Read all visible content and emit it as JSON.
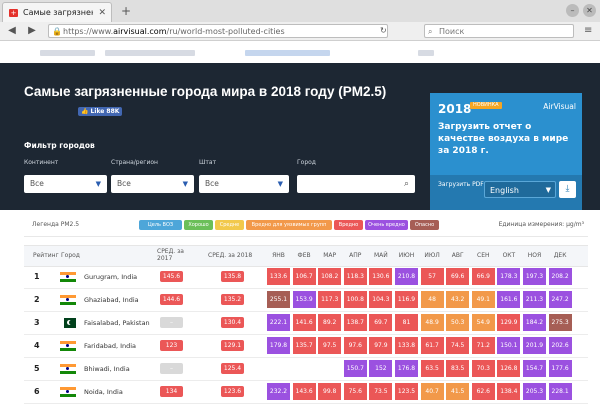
{
  "browser": {
    "tab_title": "Самые загрязнен",
    "tab_close": "✕",
    "new_tab": "+",
    "url_prefix": "https://www.",
    "url_domain": "airvisual.com",
    "url_path": "/ru/world-most-polluted-cities",
    "search_placeholder": "Поиск",
    "win_min": "–",
    "win_close": "✕"
  },
  "hero": {
    "title": "Самые загрязненные города мира в 2018 году (PM2.5)",
    "fb_like": "👍 Like 88K",
    "filter_title": "Фильтр городов",
    "filters": [
      {
        "label": "Континент",
        "value": "Все"
      },
      {
        "label": "Страна/регион",
        "value": "Все"
      },
      {
        "label": "Штат",
        "value": "Все"
      },
      {
        "label": "Город",
        "value": ""
      }
    ]
  },
  "promo": {
    "year": "2018",
    "badge": "НОВИНКА",
    "brand": "AirVisual",
    "description": "Загрузить отчет о качестве воздуха в мире за 2018 г.",
    "download_label": "Загрузить PDF",
    "language": "English"
  },
  "legend": {
    "label": "Легенда PM2.5",
    "units": "Единица измерения: µg/m³",
    "items": [
      {
        "text": "Цель ВОЗ",
        "color": "#4da6d9"
      },
      {
        "text": "Хорошо",
        "color": "#6bbf59"
      },
      {
        "text": "Средне",
        "color": "#f2c94c"
      },
      {
        "text": "Вредно для уязвимых групп",
        "color": "#f2994a"
      },
      {
        "text": "Вредно",
        "color": "#eb5757"
      },
      {
        "text": "Очень вредно",
        "color": "#9b51e0"
      },
      {
        "text": "Опасно",
        "color": "#a65e55"
      }
    ]
  },
  "table": {
    "col_rank": "Рейтинг",
    "col_city": "Город",
    "col_avg2017": "СРЕД. за 2017",
    "col_avg2018": "СРЕД. за 2018",
    "months": [
      "ЯНВ",
      "ФЕВ",
      "МАР",
      "АПР",
      "МАЙ",
      "ИЮН",
      "ИЮЛ",
      "АВГ",
      "СЕН",
      "ОКТ",
      "НОЯ",
      "ДЕК"
    ],
    "rows": [
      {
        "rank": "1",
        "flag": "in",
        "city": "Gurugram, India",
        "avg2017": "145.6",
        "avg2018": "135.8",
        "months": [
          "133.6",
          "106.7",
          "108.2",
          "118.3",
          "130.6",
          "210.8",
          "57",
          "69.6",
          "66.9",
          "178.3",
          "197.3",
          "208.2"
        ]
      },
      {
        "rank": "2",
        "flag": "in",
        "city": "Ghaziabad, India",
        "avg2017": "144.6",
        "avg2018": "135.2",
        "months": [
          "255.1",
          "153.9",
          "117.3",
          "100.8",
          "104.3",
          "116.9",
          "48",
          "43.2",
          "49.1",
          "161.6",
          "211.3",
          "247.2"
        ]
      },
      {
        "rank": "3",
        "flag": "pk",
        "city": "Faisalabad, Pakistan",
        "avg2017": "–",
        "avg2018": "130.4",
        "months": [
          "222.1",
          "141.6",
          "89.2",
          "138.7",
          "69.7",
          "81",
          "48.9",
          "50.3",
          "54.9",
          "129.9",
          "184.2",
          "275.3"
        ]
      },
      {
        "rank": "4",
        "flag": "in",
        "city": "Faridabad, India",
        "avg2017": "123",
        "avg2018": "129.1",
        "months": [
          "179.8",
          "135.7",
          "97.5",
          "97.6",
          "97.9",
          "133.8",
          "61.7",
          "74.5",
          "71.2",
          "150.1",
          "201.9",
          "202.6"
        ]
      },
      {
        "rank": "5",
        "flag": "in",
        "city": "Bhiwadi, India",
        "avg2017": "–",
        "avg2018": "125.4",
        "months": [
          "",
          "",
          "",
          "150.7",
          "152",
          "176.8",
          "63.5",
          "83.5",
          "70.3",
          "126.8",
          "154.7",
          "177.6"
        ]
      },
      {
        "rank": "6",
        "flag": "in",
        "city": "Noida, India",
        "avg2017": "134",
        "avg2018": "123.6",
        "months": [
          "232.2",
          "143.6",
          "99.8",
          "75.6",
          "73.5",
          "123.5",
          "40.7",
          "41.5",
          "62.6",
          "138.4",
          "205.3",
          "228.1"
        ]
      }
    ]
  }
}
